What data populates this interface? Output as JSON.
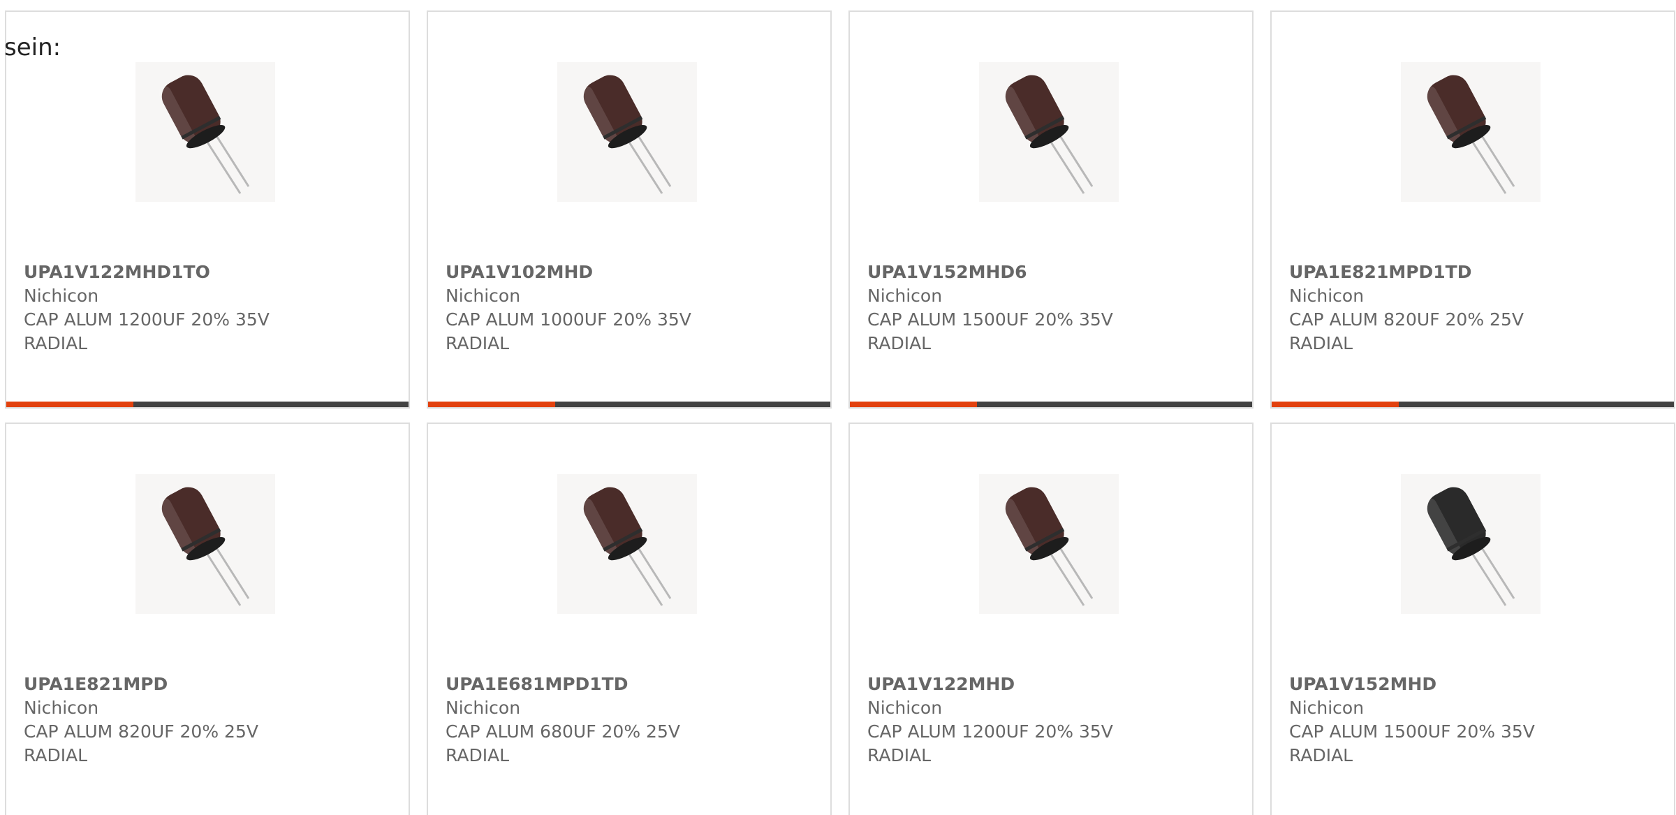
{
  "intro": {
    "text": "sein:"
  },
  "colors": {
    "accent": "#e2410e",
    "bar_dark": "#424242",
    "text_gray": "#666666",
    "border": "#dddddd",
    "capacitor_brown": "#4a2c29",
    "capacitor_black": "#2a2a2a"
  },
  "cards": [
    {
      "part": "UPA1V122MHD1TO",
      "manufacturer": "Nichicon",
      "description": "CAP ALUM 1200UF 20% 35V RADIAL",
      "image": "capacitor-brown"
    },
    {
      "part": "UPA1V102MHD",
      "manufacturer": "Nichicon",
      "description": "CAP ALUM 1000UF 20% 35V RADIAL",
      "image": "capacitor-brown"
    },
    {
      "part": "UPA1V152MHD6",
      "manufacturer": "Nichicon",
      "description": "CAP ALUM 1500UF 20% 35V RADIAL",
      "image": "capacitor-brown"
    },
    {
      "part": "UPA1E821MPD1TD",
      "manufacturer": "Nichicon",
      "description": "CAP ALUM 820UF 20% 25V RADIAL",
      "image": "capacitor-brown"
    },
    {
      "part": "UPA1E821MPD",
      "manufacturer": "Nichicon",
      "description": "CAP ALUM 820UF 20% 25V RADIAL",
      "image": "capacitor-brown"
    },
    {
      "part": "UPA1E681MPD1TD",
      "manufacturer": "Nichicon",
      "description": "CAP ALUM 680UF 20% 25V RADIAL",
      "image": "capacitor-brown"
    },
    {
      "part": "UPA1V122MHD",
      "manufacturer": "Nichicon",
      "description": "CAP ALUM 1200UF 20% 35V RADIAL",
      "image": "capacitor-brown"
    },
    {
      "part": "UPA1V152MHD",
      "manufacturer": "Nichicon",
      "description": "CAP ALUM 1500UF 20% 35V RADIAL",
      "image": "capacitor-black"
    }
  ]
}
